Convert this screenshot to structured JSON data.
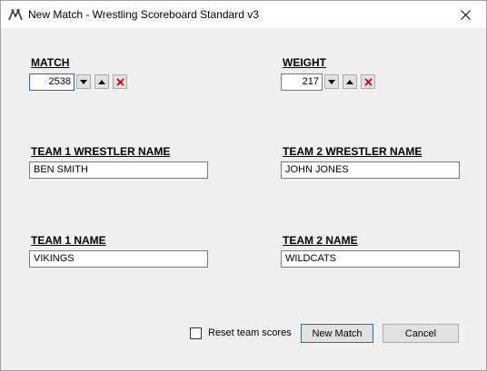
{
  "window": {
    "title": "New Match - Wrestling Scoreboard Standard v3",
    "app_icon": "wrestler-logo-icon",
    "close_icon": "close-icon"
  },
  "match": {
    "label": "MATCH",
    "value": "2538"
  },
  "weight": {
    "label": "WEIGHT",
    "value": "217"
  },
  "team1_wrestler": {
    "label": "TEAM 1 WRESTLER NAME",
    "value": "BEN SMITH"
  },
  "team2_wrestler": {
    "label": "TEAM 2 WRESTLER NAME",
    "value": "JOHN JONES"
  },
  "team1_name": {
    "label": "TEAM 1 NAME",
    "value": "VIKINGS"
  },
  "team2_name": {
    "label": "TEAM 2 NAME",
    "value": "WILDCATS"
  },
  "footer": {
    "reset_label": "Reset team scores",
    "reset_checked": false,
    "new_match_label": "New Match",
    "cancel_label": "Cancel"
  },
  "colors": {
    "accent": "#0078d7",
    "clear_red": "#d00000"
  }
}
